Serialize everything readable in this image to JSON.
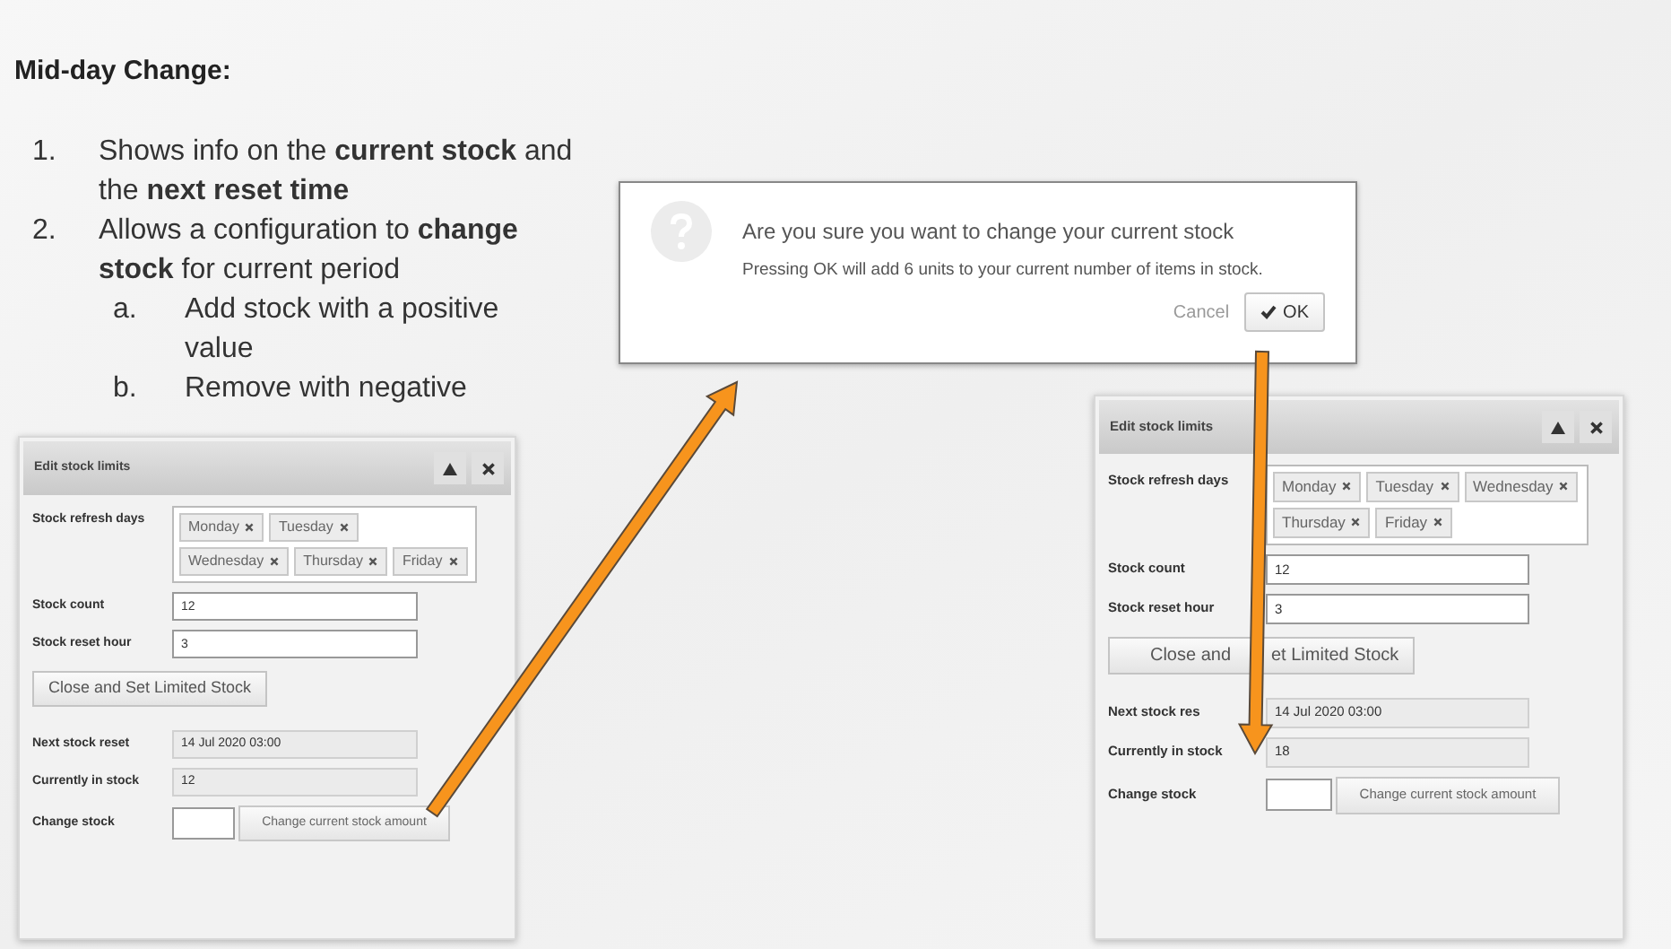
{
  "slide": {
    "title": "Mid-day Change:",
    "items": [
      {
        "number": "1.",
        "text": "Shows info on the **current stock** and the **next reset time**"
      },
      {
        "number": "2.",
        "text": "Allows a configuration to **change stock** for current period",
        "children": [
          {
            "number": "a.",
            "text": "Add stock with a positive value"
          },
          {
            "number": "b.",
            "text": "Remove with negative"
          }
        ]
      }
    ]
  },
  "confirm_dialog": {
    "title": "Are you sure you want to change your current stock",
    "message": "Pressing OK will add 6 units to your current number of items in stock.",
    "buttons": [
      {
        "label": "Cancel",
        "kind": "link"
      },
      {
        "label": "OK",
        "kind": "primary"
      }
    ]
  },
  "panels": [
    {
      "title": "Edit stock limits",
      "days_label": "Stock refresh days",
      "days": [
        "Monday",
        "Tuesday",
        "Wednesday",
        "Thursday",
        "Friday"
      ],
      "settings": [
        {
          "label": "Stock count",
          "value": "12"
        },
        {
          "label": "Stock reset hour",
          "value": "3"
        }
      ],
      "set_button": {
        "label": "Close and Set Limited Stock"
      },
      "status": [
        {
          "label": "Next stock reset",
          "value": "14 Jul 2020 03:00"
        },
        {
          "label": "Currently in stock",
          "value": "12"
        }
      ],
      "change": {
        "label": "Change stock",
        "button": "Change current stock amount"
      }
    },
    {
      "title": "Edit stock limits",
      "days_label": "Stock refresh days",
      "days": [
        "Monday",
        "Tuesday",
        "Wednesday",
        "Thursday",
        "Friday"
      ],
      "settings": [
        {
          "label": "Stock count",
          "value": "12"
        },
        {
          "label": "Stock reset hour",
          "value": "3"
        }
      ],
      "set_button": {
        "label_parts": [
          "Close and",
          "et Limited Stock"
        ]
      },
      "status": [
        {
          "label": "Next stock res",
          "value": "14 Jul 2020 03:00"
        },
        {
          "label": "Currently in stock",
          "value": "18"
        }
      ],
      "change": {
        "label": "Change stock",
        "button": "Change current stock amount"
      }
    }
  ]
}
